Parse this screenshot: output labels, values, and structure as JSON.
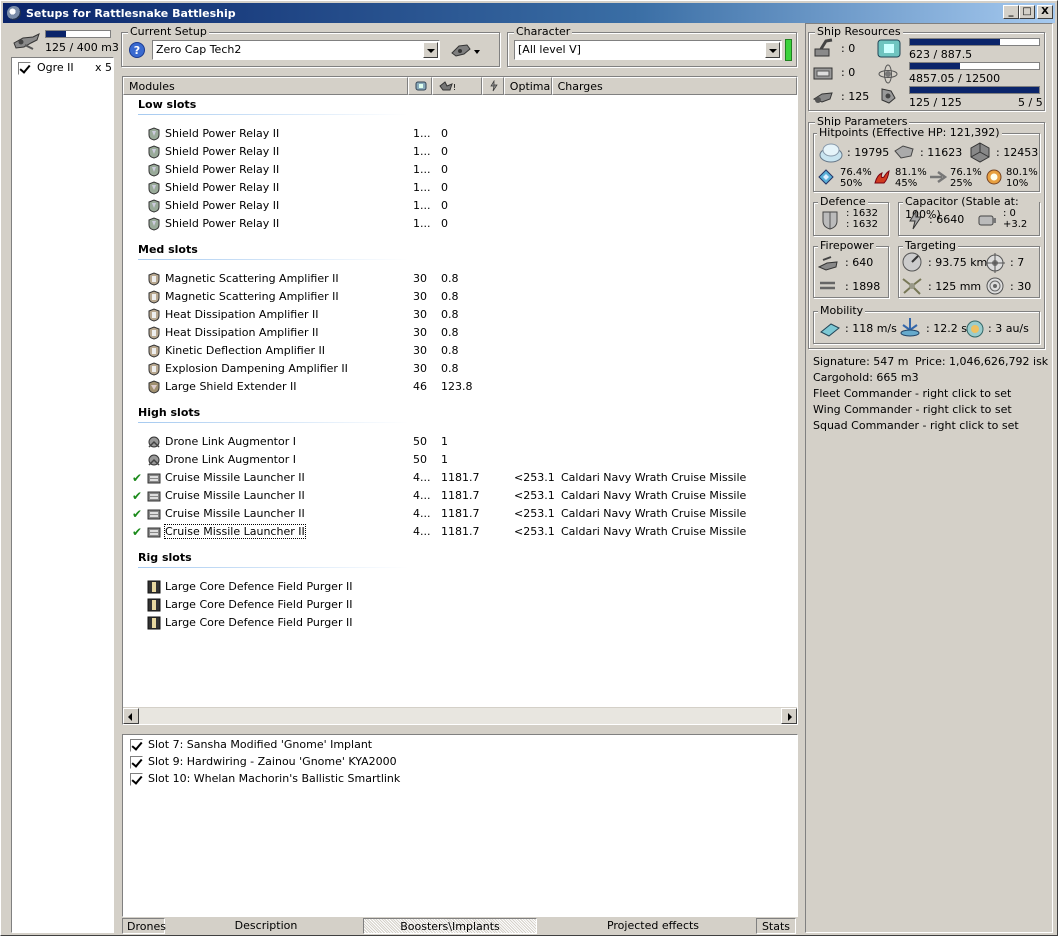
{
  "window": {
    "title": "Setups for Rattlesnake Battleship",
    "buttons": [
      "_",
      "□",
      "X"
    ]
  },
  "drones": {
    "bay_text": "125 / 400 m3",
    "bay_fill": 0.31,
    "items": [
      {
        "name": "Ogre II",
        "count": "x 5",
        "checked": true
      }
    ]
  },
  "setup": {
    "label": "Current Setup",
    "value": "Zero Cap Tech2",
    "help_icon": "question-icon",
    "ship_menu_icon": "ship-dropdown-icon"
  },
  "character": {
    "label": "Character",
    "value": "[All level V]",
    "status_color": "#3cd23c"
  },
  "modules": {
    "headers": [
      "Modules",
      "",
      "",
      "",
      "Optimal",
      "Charges"
    ],
    "header_icons": [
      "cpu-icon",
      "powergrid-icon",
      "capacitor-icon"
    ],
    "groups": [
      {
        "label": "Low slots",
        "items": [
          {
            "name": "Shield Power Relay II",
            "cpu": "1...",
            "pg": "0",
            "optimal": "",
            "charges": "",
            "icon": "shield-power-relay-icon",
            "active": false
          },
          {
            "name": "Shield Power Relay II",
            "cpu": "1...",
            "pg": "0",
            "optimal": "",
            "charges": "",
            "icon": "shield-power-relay-icon",
            "active": false
          },
          {
            "name": "Shield Power Relay II",
            "cpu": "1...",
            "pg": "0",
            "optimal": "",
            "charges": "",
            "icon": "shield-power-relay-icon",
            "active": false
          },
          {
            "name": "Shield Power Relay II",
            "cpu": "1...",
            "pg": "0",
            "optimal": "",
            "charges": "",
            "icon": "shield-power-relay-icon",
            "active": false
          },
          {
            "name": "Shield Power Relay II",
            "cpu": "1...",
            "pg": "0",
            "optimal": "",
            "charges": "",
            "icon": "shield-power-relay-icon",
            "active": false
          },
          {
            "name": "Shield Power Relay II",
            "cpu": "1...",
            "pg": "0",
            "optimal": "",
            "charges": "",
            "icon": "shield-power-relay-icon",
            "active": false
          }
        ]
      },
      {
        "label": "Med slots",
        "items": [
          {
            "name": "Magnetic Scattering Amplifier II",
            "cpu": "30",
            "pg": "0.8",
            "optimal": "",
            "charges": "",
            "icon": "shield-amplifier-icon",
            "active": false
          },
          {
            "name": "Magnetic Scattering Amplifier II",
            "cpu": "30",
            "pg": "0.8",
            "optimal": "",
            "charges": "",
            "icon": "shield-amplifier-icon",
            "active": false
          },
          {
            "name": "Heat Dissipation Amplifier II",
            "cpu": "30",
            "pg": "0.8",
            "optimal": "",
            "charges": "",
            "icon": "shield-amplifier-icon",
            "active": false
          },
          {
            "name": "Heat Dissipation Amplifier II",
            "cpu": "30",
            "pg": "0.8",
            "optimal": "",
            "charges": "",
            "icon": "shield-amplifier-icon",
            "active": false
          },
          {
            "name": "Kinetic Deflection Amplifier II",
            "cpu": "30",
            "pg": "0.8",
            "optimal": "",
            "charges": "",
            "icon": "shield-amplifier-icon",
            "active": false
          },
          {
            "name": "Explosion Dampening Amplifier II",
            "cpu": "30",
            "pg": "0.8",
            "optimal": "",
            "charges": "",
            "icon": "shield-amplifier-icon",
            "active": false
          },
          {
            "name": "Large Shield Extender II",
            "cpu": "46",
            "pg": "123.8",
            "optimal": "",
            "charges": "",
            "icon": "shield-extender-icon",
            "active": false
          }
        ]
      },
      {
        "label": "High slots",
        "items": [
          {
            "name": "Drone Link Augmentor I",
            "cpu": "50",
            "pg": "1",
            "optimal": "",
            "charges": "",
            "icon": "drone-link-icon",
            "active": false
          },
          {
            "name": "Drone Link Augmentor I",
            "cpu": "50",
            "pg": "1",
            "optimal": "",
            "charges": "",
            "icon": "drone-link-icon",
            "active": false
          },
          {
            "name": "Cruise Missile Launcher II",
            "cpu": "4...",
            "pg": "1181.7",
            "optimal": "<253.1",
            "charges": "Caldari Navy Wrath Cruise Missile",
            "icon": "missile-launcher-icon",
            "active": true
          },
          {
            "name": "Cruise Missile Launcher II",
            "cpu": "4...",
            "pg": "1181.7",
            "optimal": "<253.1",
            "charges": "Caldari Navy Wrath Cruise Missile",
            "icon": "missile-launcher-icon",
            "active": true
          },
          {
            "name": "Cruise Missile Launcher II",
            "cpu": "4...",
            "pg": "1181.7",
            "optimal": "<253.1",
            "charges": "Caldari Navy Wrath Cruise Missile",
            "icon": "missile-launcher-icon",
            "active": true
          },
          {
            "name": "Cruise Missile Launcher II",
            "cpu": "4...",
            "pg": "1181.7",
            "optimal": "<253.1",
            "charges": "Caldari Navy Wrath Cruise Missile",
            "icon": "missile-launcher-icon",
            "active": true,
            "selected": true
          }
        ]
      },
      {
        "label": "Rig slots",
        "items": [
          {
            "name": "Large Core Defence Field Purger II",
            "cpu": "",
            "pg": "",
            "optimal": "",
            "charges": "",
            "icon": "rig-icon",
            "active": false
          },
          {
            "name": "Large Core Defence Field Purger II",
            "cpu": "",
            "pg": "",
            "optimal": "",
            "charges": "",
            "icon": "rig-icon",
            "active": false
          },
          {
            "name": "Large Core Defence Field Purger II",
            "cpu": "",
            "pg": "",
            "optimal": "",
            "charges": "",
            "icon": "rig-icon",
            "active": false
          }
        ]
      }
    ]
  },
  "implants": [
    {
      "label": "Slot 7: Sansha Modified 'Gnome' Implant",
      "checked": true
    },
    {
      "label": "Slot 9: Hardwiring - Zainou 'Gnome' KYA2000",
      "checked": true
    },
    {
      "label": "Slot 10: Whelan Machorin's Ballistic Smartlink",
      "checked": true
    }
  ],
  "tabs": [
    "Drones",
    "Description",
    "Boosters\\Implants",
    "Projected effects",
    "Stats"
  ],
  "active_tab": "Boosters\\Implants",
  "resources": {
    "label": "Ship Resources",
    "turret": ": 0",
    "launcher": ": 0",
    "drone_bandwidth": ": 125",
    "cpu_text": "623 / 887.5",
    "cpu_fill": 0.7,
    "pg_text": "4857.05 / 12500",
    "pg_fill": 0.39,
    "drone_text": "125 / 125",
    "drone_fill": 1.0,
    "drones_active": "5 / 5"
  },
  "params": {
    "label": "Ship Parameters",
    "hitpoints_label": "Hitpoints (Effective HP: 121,392)",
    "shield_hp": ": 19795",
    "armor_hp": ": 11623",
    "structure_hp": ": 12453",
    "resists": [
      {
        "icon": "em-resist-icon",
        "a": "76.4%",
        "b": "50%"
      },
      {
        "icon": "thermal-resist-icon",
        "a": "81.1%",
        "b": "45%"
      },
      {
        "icon": "kinetic-resist-icon",
        "a": "76.1%",
        "b": "25%"
      },
      {
        "icon": "explosive-resist-icon",
        "a": "80.1%",
        "b": "10%"
      }
    ],
    "defence_label": "Defence",
    "defence_a": ": 1632",
    "defence_b": ": 1632",
    "capacitor_label": "Capacitor (Stable at: 100%)",
    "cap_amount": ": 6640",
    "cap_a": ": 0",
    "cap_b": "+3.2",
    "firepower_label": "Firepower",
    "volley": ": 640",
    "dps": ": 1898",
    "targeting_label": "Targeting",
    "range": ": 93.75 km",
    "max_targets": ": 7",
    "scan_res": ": 125 mm",
    "sensor": ": 30",
    "mobility_label": "Mobility",
    "speed": ": 118 m/s",
    "align": ": 12.2 s",
    "warp": ": 3 au/s",
    "signature": "Signature: 547 m",
    "price": "Price: 1,046,626,792 isk",
    "cargohold": "Cargohold: 665 m3",
    "fleet": "Fleet Commander - right click to set",
    "wing": "Wing Commander - right click to set",
    "squad": "Squad Commander - right click to set"
  }
}
